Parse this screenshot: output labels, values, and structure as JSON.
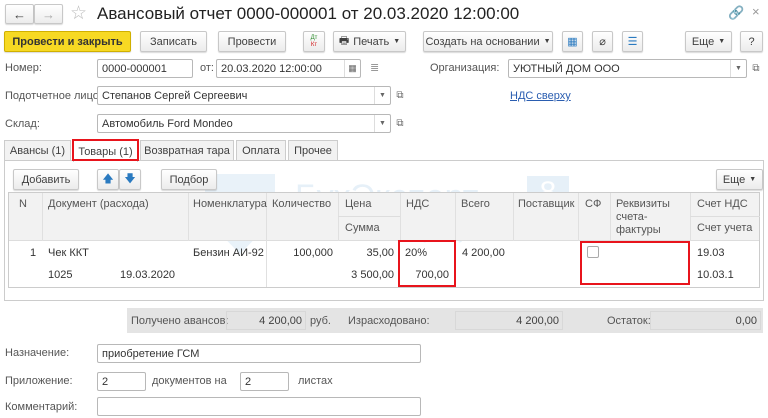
{
  "window": {
    "title": "Авансовый отчет 0000-000001 от 20.03.2020 12:00:00"
  },
  "toolbar": {
    "post_close": "Провести и закрыть",
    "save": "Записать",
    "post": "Провести",
    "dtkt_dt": "Дт",
    "dtkt_kt": "Кт",
    "print": "Печать",
    "create_based": "Создать на основании",
    "more": "Еще",
    "help": "?"
  },
  "header": {
    "number_label": "Номер:",
    "number": "0000-000001",
    "date_label": "от:",
    "date": "20.03.2020 12:00:00",
    "org_label": "Организация:",
    "org": "УЮТНЫЙ ДОМ ООО",
    "person_label": "Подотчетное лицо:",
    "person": "Степанов Сергей Сергеевич",
    "vat_link": "НДС сверху",
    "warehouse_label": "Склад:",
    "warehouse": "Автомобиль Ford Mondeo"
  },
  "tabs": [
    {
      "label": "Авансы (1)"
    },
    {
      "label": "Товары (1)"
    },
    {
      "label": "Возвратная тара"
    },
    {
      "label": "Оплата"
    },
    {
      "label": "Прочее"
    }
  ],
  "table_toolbar": {
    "add": "Добавить",
    "pick": "Подбор",
    "more": "Еще"
  },
  "watermark": {
    "title": "БухЭксперт",
    "subtitle": "База ответов по учёту в 1С",
    "logo": "8"
  },
  "columns": {
    "n": "N",
    "doc": "Документ (расхода)",
    "item": "Номенклатура",
    "qty": "Количество",
    "price": "Цена",
    "sum": "Сумма",
    "vat": "НДС",
    "total": "Всего",
    "supplier": "Поставщик",
    "sf": "СФ",
    "invoice": "Реквизиты счета-фактуры",
    "vat_acc": "Счет НДС",
    "acc": "Счет учета"
  },
  "rows": [
    {
      "n": "1",
      "doc": "Чек ККТ",
      "doc_no": "1025",
      "doc_date": "19.03.2020",
      "item": "Бензин АИ-92",
      "qty": "100,000",
      "price": "35,00",
      "sum": "3 500,00",
      "vat_rate": "20%",
      "vat_sum": "700,00",
      "total": "4 200,00",
      "sf_checked": false,
      "vat_acc": "19.03",
      "acc": "10.03.1"
    }
  ],
  "totals": {
    "received_label": "Получено авансов:",
    "received": "4 200,00",
    "currency": "руб.",
    "spent_label": "Израсходовано:",
    "spent": "4 200,00",
    "rest_label": "Остаток:",
    "rest": "0,00"
  },
  "footer": {
    "purpose_label": "Назначение:",
    "purpose": "приобретение ГСМ",
    "attach_label": "Приложение:",
    "docs": "2",
    "docs_text": "документов на",
    "sheets": "2",
    "sheets_text": "листах",
    "comment_label": "Комментарий:",
    "comment": ""
  }
}
